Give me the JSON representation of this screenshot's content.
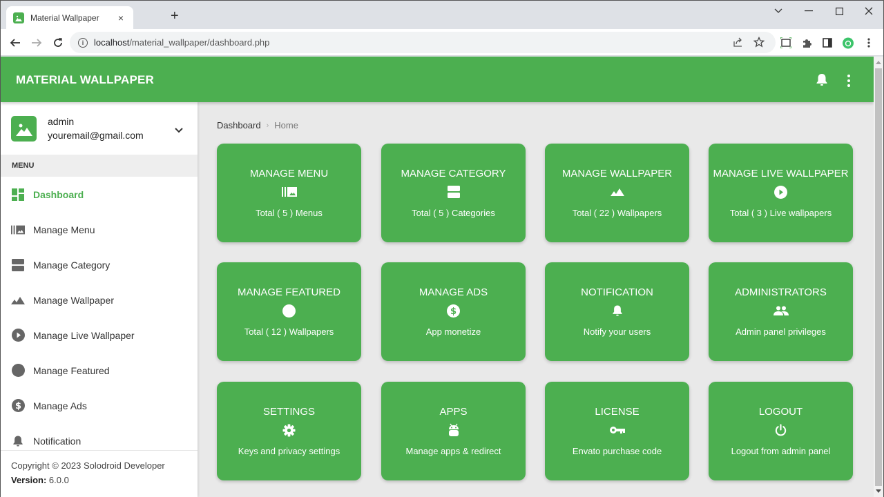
{
  "browser": {
    "tab_title": "Material Wallpaper",
    "url_host": "localhost",
    "url_path": "/material_wallpaper/dashboard.php",
    "tab_close": "×",
    "new_tab": "+"
  },
  "app": {
    "title": "MATERIAL WALLPAPER",
    "accent_color": "#4caf50"
  },
  "user": {
    "name": "admin",
    "email": "youremail@gmail.com"
  },
  "sidebar": {
    "menu_header": "MENU",
    "items": [
      {
        "label": "Dashboard",
        "icon": "dashboard-icon",
        "active": true
      },
      {
        "label": "Manage Menu",
        "icon": "photo-library-icon"
      },
      {
        "label": "Manage Category",
        "icon": "category-icon"
      },
      {
        "label": "Manage Wallpaper",
        "icon": "landscape-icon"
      },
      {
        "label": "Manage Live Wallpaper",
        "icon": "play-circle-icon"
      },
      {
        "label": "Manage Featured",
        "icon": "circle-icon"
      },
      {
        "label": "Manage Ads",
        "icon": "dollar-icon"
      },
      {
        "label": "Notification",
        "icon": "bell-icon"
      }
    ],
    "footer": {
      "copyright": "Copyright © 2023 Solodroid Developer",
      "version_label": "Version:",
      "version_value": "6.0.0"
    }
  },
  "breadcrumb": {
    "root": "Dashboard",
    "separator": "›",
    "current": "Home"
  },
  "cards": [
    {
      "title": "MANAGE MENU",
      "icon": "photo-library-icon",
      "subtitle": "Total ( 5 ) Menus"
    },
    {
      "title": "MANAGE CATEGORY",
      "icon": "category-icon",
      "subtitle": "Total ( 5 ) Categories"
    },
    {
      "title": "MANAGE WALLPAPER",
      "icon": "landscape-icon",
      "subtitle": "Total ( 22 ) Wallpapers"
    },
    {
      "title": "MANAGE LIVE WALLPAPER",
      "icon": "play-circle-icon",
      "subtitle": "Total ( 3 ) Live wallpapers"
    },
    {
      "title": "MANAGE FEATURED",
      "icon": "circle-icon",
      "subtitle": "Total ( 12 ) Wallpapers"
    },
    {
      "title": "MANAGE ADS",
      "icon": "dollar-icon",
      "subtitle": "App monetize"
    },
    {
      "title": "NOTIFICATION",
      "icon": "bell-icon",
      "subtitle": "Notify your users"
    },
    {
      "title": "ADMINISTRATORS",
      "icon": "people-icon",
      "subtitle": "Admin panel privileges"
    },
    {
      "title": "SETTINGS",
      "icon": "gear-icon",
      "subtitle": "Keys and privacy settings"
    },
    {
      "title": "APPS",
      "icon": "android-icon",
      "subtitle": "Manage apps & redirect"
    },
    {
      "title": "LICENSE",
      "icon": "key-icon",
      "subtitle": "Envato purchase code"
    },
    {
      "title": "LOGOUT",
      "icon": "power-icon",
      "subtitle": "Logout from admin panel"
    }
  ]
}
